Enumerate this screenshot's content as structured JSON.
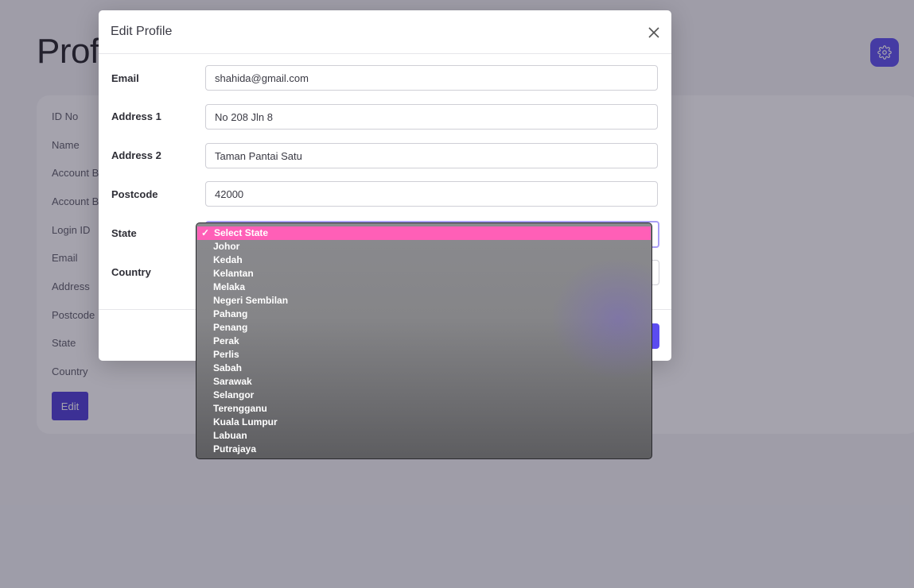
{
  "page": {
    "title": "Profile",
    "info_labels": [
      "ID No",
      "Name",
      "Account Balance",
      "Account Balance",
      "Login ID",
      "Email",
      "Address",
      "Postcode",
      "State",
      "Country"
    ],
    "edit_label": "Edit"
  },
  "modal": {
    "title": "Edit Profile",
    "fields": {
      "email": {
        "label": "Email",
        "value": "shahida@gmail.com"
      },
      "address1": {
        "label": "Address 1",
        "value": "No 208 Jln 8"
      },
      "address2": {
        "label": "Address 2",
        "value": "Taman Pantai Satu"
      },
      "postcode": {
        "label": "Postcode",
        "value": "42000"
      },
      "state": {
        "label": "State"
      },
      "country": {
        "label": "Country"
      }
    }
  },
  "state_dropdown": {
    "selected_check": "✓",
    "options": [
      "Select State",
      "Johor",
      "Kedah",
      "Kelantan",
      "Melaka",
      "Negeri Sembilan",
      "Pahang",
      "Penang",
      "Perak",
      "Perlis",
      "Sabah",
      "Sarawak",
      "Selangor",
      "Terengganu",
      "Kuala Lumpur",
      "Labuan",
      "Putrajaya"
    ]
  },
  "colors": {
    "accent": "#5b4cf0",
    "selected_option": "#ff5fb7"
  },
  "icons": {
    "close": "close-icon",
    "settings": "gear-icon"
  }
}
